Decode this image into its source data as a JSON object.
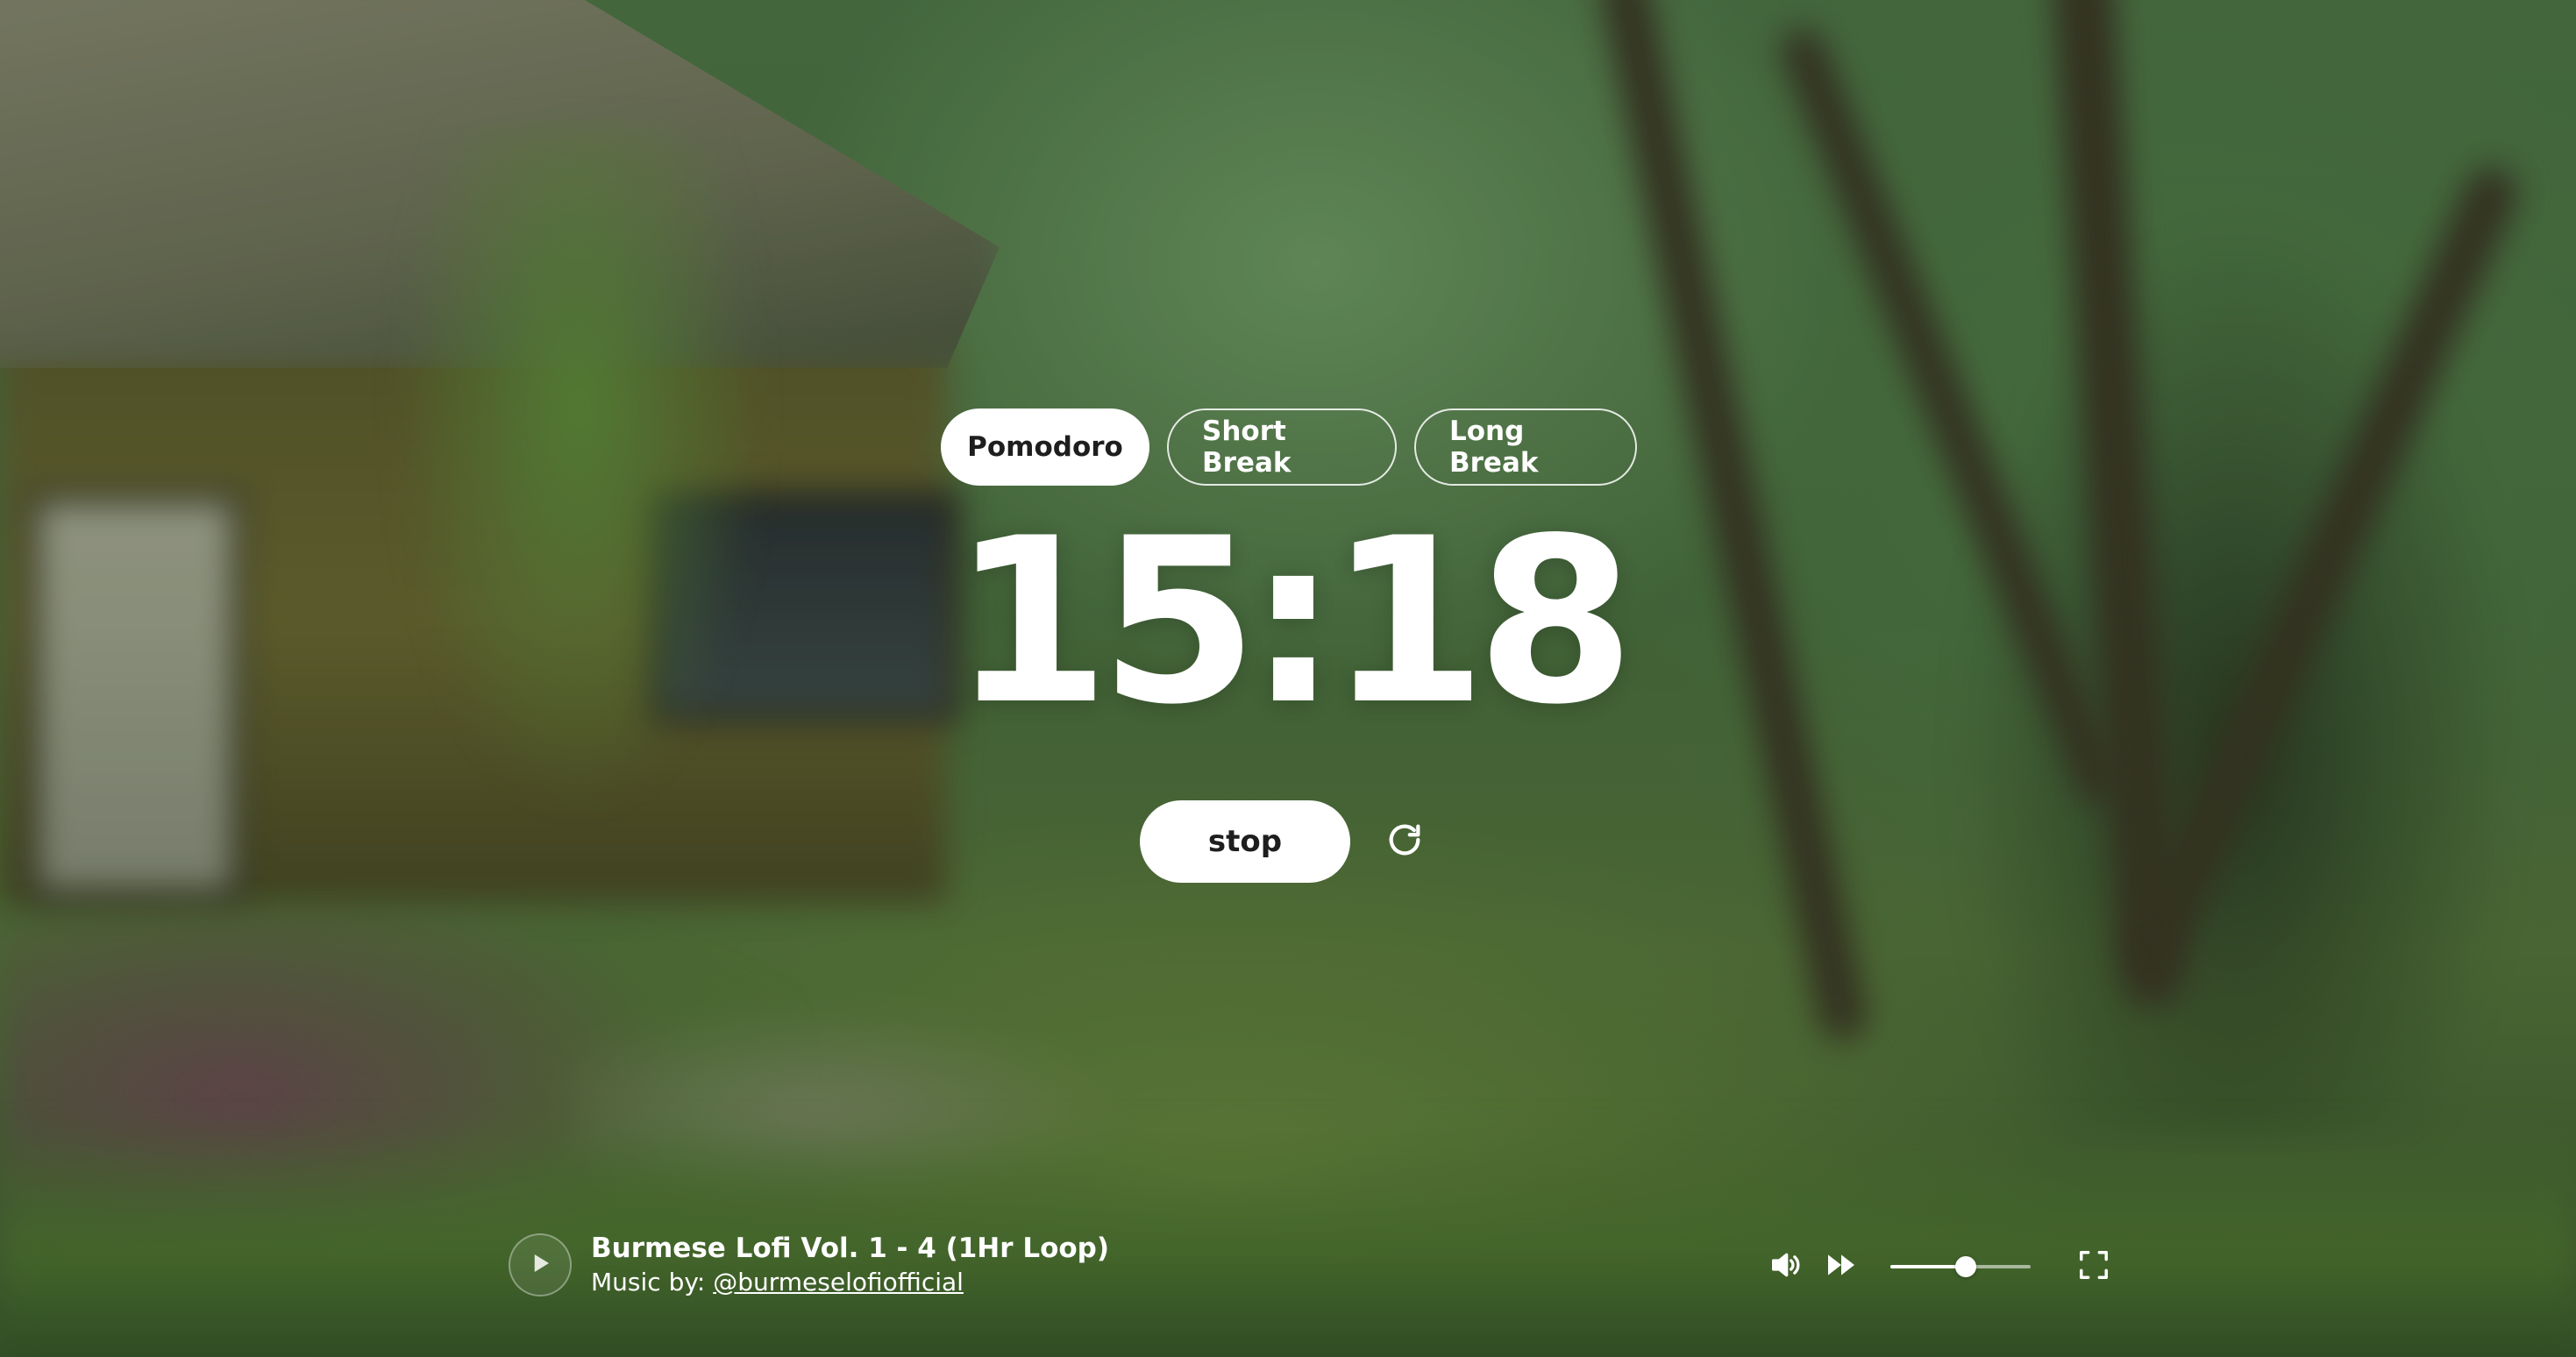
{
  "modes": {
    "pomodoro": "Pomodoro",
    "short_break": "Short Break",
    "long_break": "Long Break",
    "active": "pomodoro"
  },
  "timer": {
    "display": "15:18"
  },
  "controls": {
    "stop_label": "stop",
    "reset_icon": "reset-icon"
  },
  "player": {
    "play_icon": "play-icon",
    "track_title": "Burmese Lofi Vol. 1 - 4 (1Hr Loop)",
    "credit_prefix": "Music by:",
    "credit_handle": "@burmeselofiofficial",
    "volume_icon": "volume-icon",
    "skip_icon": "skip-forward-icon",
    "volume_level": 0.54,
    "fullscreen_icon": "fullscreen-icon"
  },
  "colors": {
    "accent": "#ffffff",
    "text_dark": "#1e1e1e"
  }
}
